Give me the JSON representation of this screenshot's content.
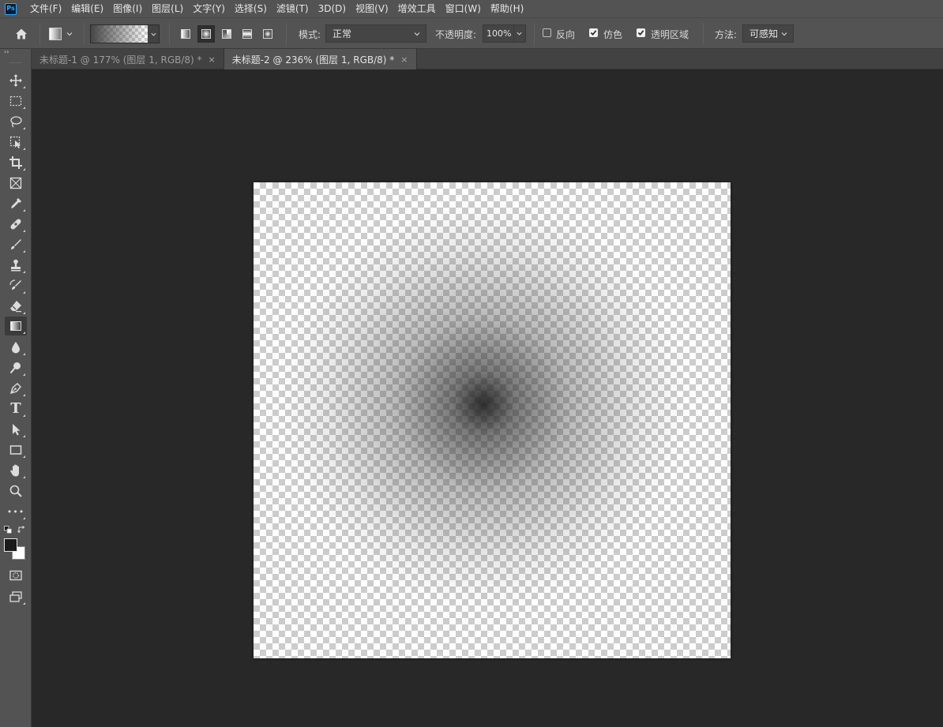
{
  "app": {
    "logo": "Ps"
  },
  "menu": [
    "文件(F)",
    "编辑(E)",
    "图像(I)",
    "图层(L)",
    "文字(Y)",
    "选择(S)",
    "滤镜(T)",
    "3D(D)",
    "视图(V)",
    "增效工具",
    "窗口(W)",
    "帮助(H)"
  ],
  "options": {
    "mode_label": "模式:",
    "mode_value": "正常",
    "opacity_label": "不透明度:",
    "opacity_value": "100%",
    "reverse_label": "反向",
    "reverse_checked": false,
    "dither_label": "仿色",
    "dither_checked": true,
    "transparency_label": "透明区域",
    "transparency_checked": true,
    "method_label": "方法:",
    "method_value": "可感知",
    "gradient_types": [
      "linear",
      "radial",
      "angle",
      "reflected",
      "diamond"
    ],
    "active_gradient_type": "radial"
  },
  "tabs": [
    {
      "label": "未标题-1 @ 177% (图层 1, RGB/8) *",
      "close": "×",
      "active": false
    },
    {
      "label": "未标题-2 @ 236% (图层 1, RGB/8) *",
      "close": "×",
      "active": true
    }
  ],
  "toolbar": {
    "collapse_glyph": "››",
    "tools": [
      "move",
      "marquee",
      "lasso",
      "object-select",
      "crop",
      "frame",
      "eyedropper",
      "healing-brush",
      "brush",
      "clone-stamp",
      "history-brush",
      "eraser",
      "gradient",
      "blur",
      "dodge",
      "pen",
      "type",
      "path-select",
      "rectangle",
      "hand",
      "zoom",
      "more"
    ],
    "active_tool": "gradient",
    "type_tool_glyph": "T",
    "more_glyph": "•••"
  },
  "colors": {
    "foreground": "#1a1a1a",
    "background": "#ffffff"
  }
}
